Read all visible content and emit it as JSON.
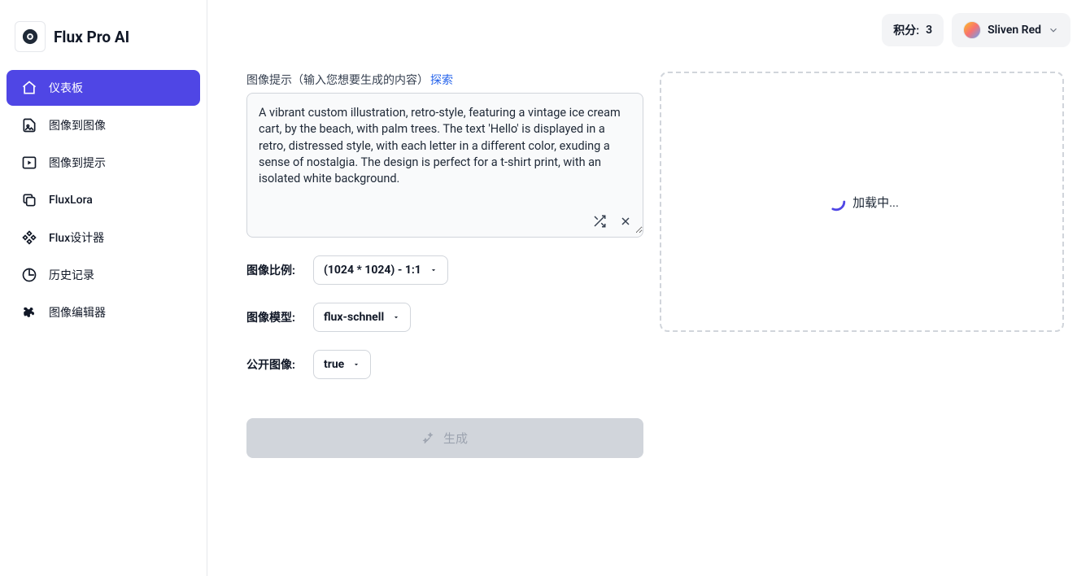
{
  "brand": {
    "name": "Flux Pro AI"
  },
  "sidebar": {
    "items": [
      {
        "label": "仪表板"
      },
      {
        "label": "图像到图像"
      },
      {
        "label": "图像到提示"
      },
      {
        "label": "FluxLora"
      },
      {
        "label": "Flux设计器"
      },
      {
        "label": "历史记录"
      },
      {
        "label": "图像编辑器"
      }
    ]
  },
  "header": {
    "credits_label": "积分:",
    "credits_value": "3",
    "user_name": "Sliven Red"
  },
  "prompt": {
    "label": "图像提示（输入您想要生成的内容）",
    "explore": "探索",
    "value": "A vibrant custom illustration, retro-style, featuring a vintage ice cream cart, by the beach, with palm trees. The text 'Hello' is displayed in a retro, distressed style, with each letter in a different color, exuding a sense of nostalgia. The design is perfect for a t-shirt print, with an isolated white background."
  },
  "fields": {
    "ratio_label": "图像比例:",
    "ratio_value": "(1024 * 1024) - 1:1",
    "model_label": "图像模型:",
    "model_value": "flux-schnell",
    "public_label": "公开图像:",
    "public_value": "true"
  },
  "actions": {
    "generate": "生成"
  },
  "preview": {
    "loading": "加载中..."
  }
}
